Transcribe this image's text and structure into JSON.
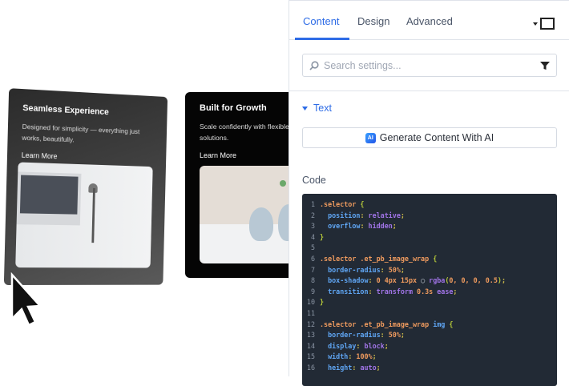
{
  "cards": [
    {
      "title": "Seamless Experience",
      "desc": "Designed for simplicity — everything just works, beautifully.",
      "link": "Learn More"
    },
    {
      "title": "Built for Growth",
      "desc": "Scale confidently with flexible, ready solutions.",
      "link": "Learn More"
    }
  ],
  "panel": {
    "tabs": [
      "Content",
      "Design",
      "Advanced"
    ],
    "search_placeholder": "Search settings...",
    "section": "Text",
    "ai_icon": "AI",
    "ai_button": "Generate Content With AI",
    "code_label": "Code",
    "code": [
      [
        [
          "sel",
          ".selector "
        ],
        [
          "br",
          "{"
        ]
      ],
      [
        [
          "t",
          "  "
        ],
        [
          "prop",
          "position"
        ],
        [
          "p",
          ": "
        ],
        [
          "val",
          "relative"
        ],
        [
          "p",
          ";"
        ]
      ],
      [
        [
          "t",
          "  "
        ],
        [
          "prop",
          "overflow"
        ],
        [
          "p",
          ": "
        ],
        [
          "val",
          "hidden"
        ],
        [
          "p",
          ";"
        ]
      ],
      [
        [
          "br",
          "}"
        ]
      ],
      [],
      [
        [
          "sel",
          ".selector .et_pb_image_wrap "
        ],
        [
          "br",
          "{"
        ]
      ],
      [
        [
          "t",
          "  "
        ],
        [
          "prop",
          "border-radius"
        ],
        [
          "p",
          ": "
        ],
        [
          "num",
          "50%"
        ],
        [
          "p",
          ";"
        ]
      ],
      [
        [
          "t",
          "  "
        ],
        [
          "prop",
          "box-shadow"
        ],
        [
          "p",
          ": "
        ],
        [
          "num",
          "0 4px 15px "
        ],
        [
          "t",
          "◯ "
        ],
        [
          "val",
          "rgba"
        ],
        [
          "br",
          "("
        ],
        [
          "num",
          "0, 0, 0, 0.5"
        ],
        [
          "br",
          ")"
        ],
        [
          "p",
          ";"
        ]
      ],
      [
        [
          "t",
          "  "
        ],
        [
          "prop",
          "transition"
        ],
        [
          "p",
          ": "
        ],
        [
          "val",
          "transform "
        ],
        [
          "num",
          "0.3s "
        ],
        [
          "val",
          "ease"
        ],
        [
          "p",
          ";"
        ]
      ],
      [
        [
          "br",
          "}"
        ]
      ],
      [],
      [
        [
          "sel",
          ".selector .et_pb_image_wrap "
        ],
        [
          "prop",
          "img "
        ],
        [
          "br",
          "{"
        ]
      ],
      [
        [
          "t",
          "  "
        ],
        [
          "prop",
          "border-radius"
        ],
        [
          "p",
          ": "
        ],
        [
          "num",
          "50%"
        ],
        [
          "p",
          ";"
        ]
      ],
      [
        [
          "t",
          "  "
        ],
        [
          "prop",
          "display"
        ],
        [
          "p",
          ": "
        ],
        [
          "val",
          "block"
        ],
        [
          "p",
          ";"
        ]
      ],
      [
        [
          "t",
          "  "
        ],
        [
          "prop",
          "width"
        ],
        [
          "p",
          ": "
        ],
        [
          "num",
          "100%"
        ],
        [
          "p",
          ";"
        ]
      ],
      [
        [
          "t",
          "  "
        ],
        [
          "prop",
          "height"
        ],
        [
          "p",
          ": "
        ],
        [
          "val",
          "auto"
        ],
        [
          "p",
          ";"
        ]
      ]
    ]
  }
}
